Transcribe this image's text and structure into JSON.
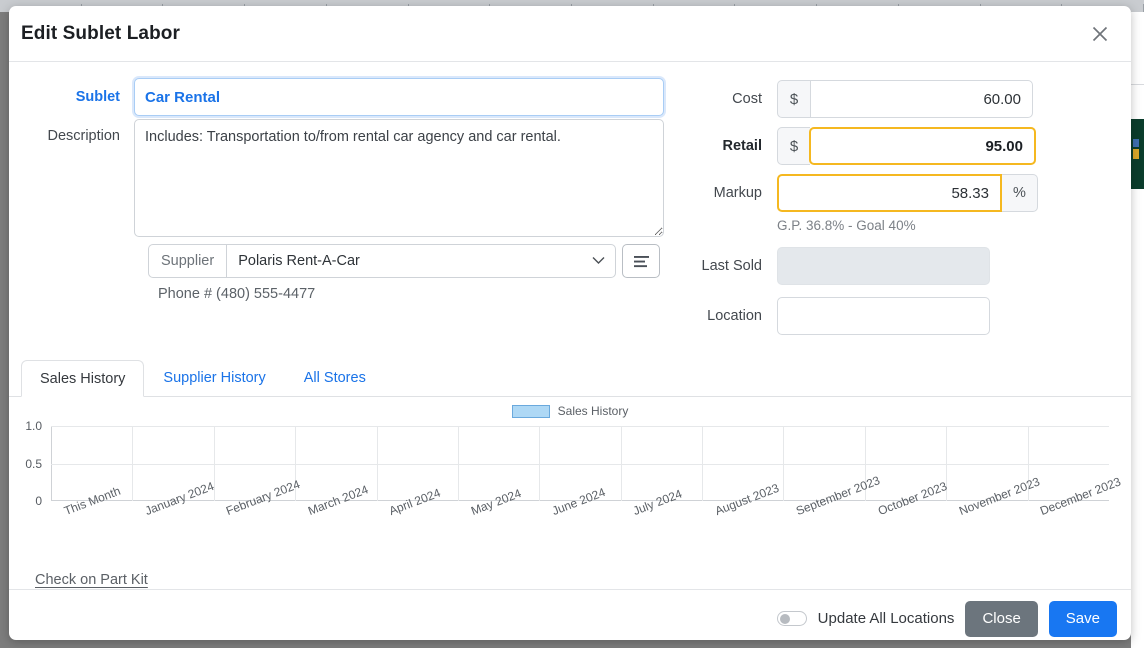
{
  "window": {
    "title": "Edit Sublet Labor",
    "close_icon": "close-icon"
  },
  "form": {
    "sublet": {
      "label": "Sublet",
      "value": "Car Rental",
      "placeholder": ""
    },
    "description": {
      "label": "Description",
      "value": "Includes: Transportation to/from rental car agency and car rental.",
      "placeholder": ""
    },
    "supplier": {
      "tag_label": "Supplier",
      "value": "Polaris Rent-A-Car",
      "caret_icon": "chevron-down-icon",
      "list_icon": "list-lines-icon"
    },
    "phone": "Phone # (480) 555-4477",
    "cost": {
      "label": "Cost",
      "prefix": "$",
      "value": "60.00"
    },
    "retail": {
      "label": "Retail",
      "prefix": "$",
      "value": "95.00",
      "highlight_color": "#f5b820"
    },
    "markup": {
      "label": "Markup",
      "value": "58.33",
      "suffix": "%",
      "highlight_color": "#f5b820"
    },
    "gp_note": "G.P. 36.8% - Goal 40%",
    "last_sold": {
      "label": "Last Sold",
      "value": "",
      "placeholder": ""
    },
    "location": {
      "label": "Location",
      "value": "",
      "placeholder": ""
    }
  },
  "tabs": [
    {
      "label": "Sales History",
      "active": true
    },
    {
      "label": "Supplier History",
      "active": false
    },
    {
      "label": "All Stores",
      "active": false
    }
  ],
  "links": {
    "part_kit": "Check on Part Kit"
  },
  "footer": {
    "toggle_label": "Update All Locations",
    "toggle_on": false,
    "close_label": "Close",
    "save_label": "Save",
    "save_color": "#1877f2",
    "close_color": "#6c757d"
  },
  "chart_data": {
    "type": "bar",
    "title": "",
    "legend": [
      "Sales History"
    ],
    "legend_position": "top-center",
    "series_color": "#aed8f5",
    "grid": true,
    "xlabel": "",
    "ylabel": "",
    "ylim": [
      0,
      1
    ],
    "yticks": [
      "1.0",
      "0.5",
      "0"
    ],
    "ytick_values": [
      1.0,
      0.5,
      0
    ],
    "categories": [
      "This Month",
      "January 2024",
      "February 2024",
      "March 2024",
      "April 2024",
      "May 2024",
      "June 2024",
      "July 2024",
      "August 2023",
      "September 2023",
      "October 2023",
      "November 2023",
      "December 2023"
    ],
    "series": [
      {
        "name": "Sales History",
        "values": [
          0,
          0,
          0,
          0,
          0,
          0,
          0,
          0,
          0,
          0,
          0,
          0,
          0
        ]
      }
    ]
  }
}
